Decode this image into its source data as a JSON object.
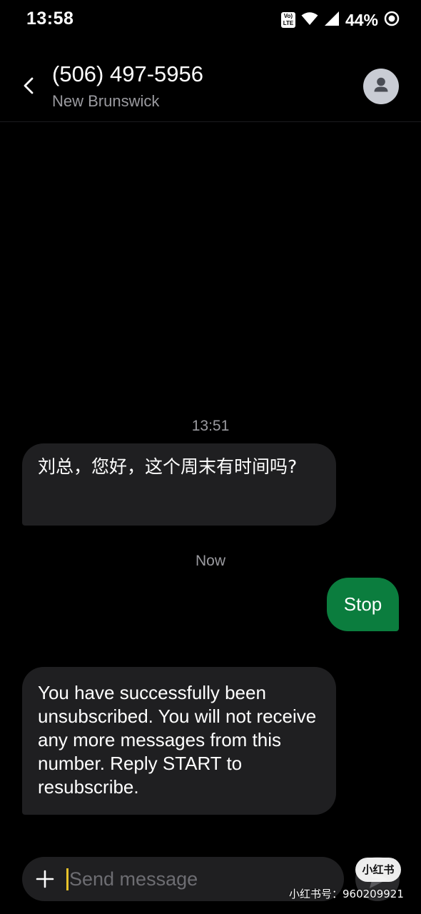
{
  "status_bar": {
    "time": "13:58",
    "volte_top": "Vo)",
    "volte_bottom": "LTE",
    "battery": "44%",
    "icons": [
      "volte-icon",
      "wifi-icon",
      "signal-icon",
      "record-icon"
    ]
  },
  "header": {
    "contact_number": "(506) 497-5956",
    "contact_location": "New Brunswick",
    "back_icon": "chevron-left-icon",
    "avatar_icon": "person-icon"
  },
  "messages": [
    {
      "timestamp": "13:51",
      "direction": "incoming",
      "text": "刘总，您好，这个周末有时间吗?"
    },
    {
      "timestamp": "Now",
      "direction": "outgoing",
      "text": "Stop"
    },
    {
      "timestamp": "",
      "direction": "incoming",
      "text": "You have successfully been unsubscribed. You will not receive any more messages from this number. Reply START to resubscribe."
    }
  ],
  "composer": {
    "placeholder": "Send message",
    "value": "",
    "add_icon": "plus-icon",
    "send_icon": "send-icon"
  },
  "watermark": {
    "logo": "小红书",
    "text": "小红书号：960209921"
  },
  "colors": {
    "background": "#000000",
    "incoming_bubble": "#1f1f21",
    "outgoing_bubble": "#0b7d3e",
    "secondary_text": "#9a9a9f",
    "cursor": "#e8c32a"
  }
}
